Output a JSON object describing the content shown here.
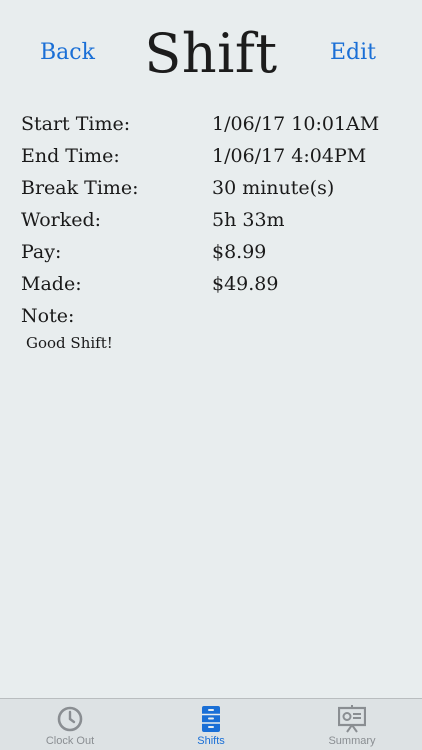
{
  "nav": {
    "back_label": "Back",
    "title": "Shift",
    "edit_label": "Edit"
  },
  "details": [
    {
      "label": "Start Time:",
      "value": "1/06/17 10:01AM"
    },
    {
      "label": "End Time:",
      "value": "1/06/17 4:04PM"
    },
    {
      "label": "Break Time:",
      "value": "30 minute(s)"
    },
    {
      "label": "Worked:",
      "value": "5h 33m"
    },
    {
      "label": "Pay:",
      "value": "$8.99"
    },
    {
      "label": "Made:",
      "value": "$49.89"
    }
  ],
  "note": {
    "label": "Note:",
    "text": "Good Shift!"
  },
  "tabs": [
    {
      "label": "Clock Out",
      "icon": "clock-icon",
      "active": false
    },
    {
      "label": "Shifts",
      "icon": "filing-cabinet-icon",
      "active": true
    },
    {
      "label": "Summary",
      "icon": "presentation-board-icon",
      "active": false
    }
  ],
  "colors": {
    "accent": "#1a6fd6",
    "inactive": "#8a8e92",
    "background": "#e8edee"
  }
}
